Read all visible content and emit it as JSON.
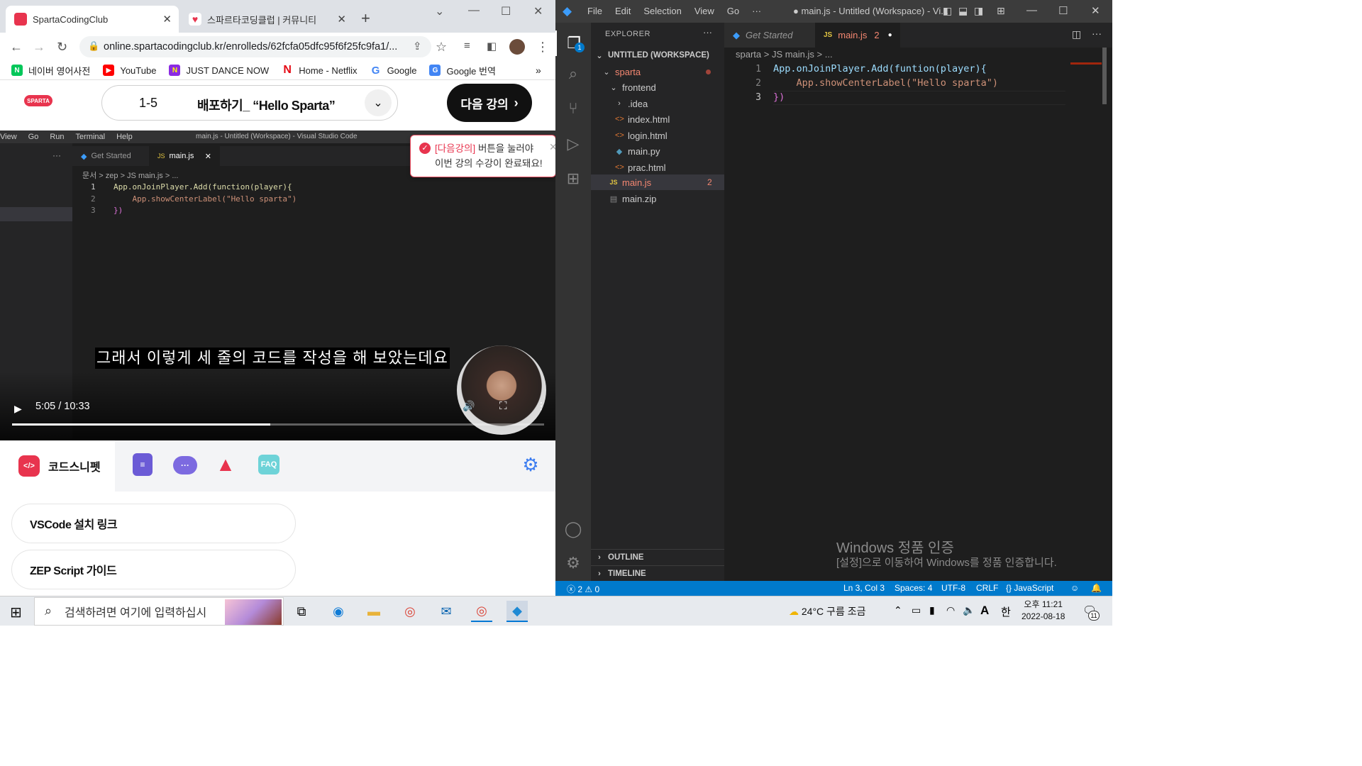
{
  "chrome": {
    "tabs": [
      {
        "title": "SpartaCodingClub",
        "active": true
      },
      {
        "title": "스파르타코딩클럽 | 커뮤니티",
        "active": false
      }
    ],
    "url": "online.spartacodingclub.kr/enrolleds/62fcfa05dfc95f6f25fc9fa1/...",
    "bookmarks": [
      {
        "label": "네이버 영어사전",
        "icon": "naver-icon",
        "color": "#03c75a"
      },
      {
        "label": "YouTube",
        "icon": "youtube-icon",
        "color": "#ff0000"
      },
      {
        "label": "JUST DANCE NOW",
        "icon": "just-dance-icon",
        "color": "#8b2be2"
      },
      {
        "label": "Home - Netflix",
        "icon": "netflix-icon",
        "color": "#e50914"
      },
      {
        "label": "Google",
        "icon": "google-icon",
        "color": "#4285f4"
      },
      {
        "label": "Google 번역",
        "icon": "google-translate-icon",
        "color": "#4285f4"
      }
    ],
    "bookmarks_more": "»"
  },
  "page": {
    "logo": "SPARTA",
    "lesson_number": "1-5",
    "lesson_title": "배포하기_ “Hello Sparta”",
    "next_button": "다음 강의",
    "tooltip_line1_bold": "[다음강의]",
    "tooltip_line1_rest": " 버튼을 눌러야",
    "tooltip_line2": "이번 강의 수강이 완료돼요!",
    "video": {
      "menu": [
        "View",
        "Go",
        "Run",
        "Terminal",
        "Help"
      ],
      "window_title": "main.js - Untitled (Workspace) - Visual Studio Code",
      "tabs": [
        "Get Started",
        "main.js"
      ],
      "breadcrumb": "문서 > zep > JS main.js > ...",
      "code_lines": [
        "App.onJoinPlayer.Add(function(player){",
        "    App.showCenterLabel(\"Hello sparta\")",
        "})"
      ],
      "subtitle": "그래서 이렇게 세 줄의 코드를 작성을 해 보았는데요",
      "time": "5:05 / 10:33",
      "progress": 0.485
    },
    "snippet_tab": "코드스니펫",
    "snippet_icon_text": "</>",
    "faq": "FAQ",
    "links": [
      "VSCode 설치 링크",
      "ZEP Script 가이드"
    ]
  },
  "vscode": {
    "menu": [
      "File",
      "Edit",
      "Selection",
      "View",
      "Go",
      "···"
    ],
    "title": "● main.js - Untitled (Workspace) - Vi...",
    "explorer_title": "EXPLORER",
    "workspace": "UNTITLED (WORKSPACE)",
    "tree": [
      {
        "label": "sparta",
        "depth": 0,
        "type": "folder-open",
        "color": "#f48771"
      },
      {
        "label": "frontend",
        "depth": 1,
        "type": "folder-open",
        "color": "#cccccc"
      },
      {
        "label": ".idea",
        "depth": 2,
        "type": "folder",
        "color": "#cccccc"
      },
      {
        "label": "index.html",
        "depth": 2,
        "type": "html",
        "color": "#cccccc"
      },
      {
        "label": "login.html",
        "depth": 2,
        "type": "html",
        "color": "#cccccc"
      },
      {
        "label": "main.py",
        "depth": 2,
        "type": "py",
        "color": "#cccccc"
      },
      {
        "label": "prac.html",
        "depth": 2,
        "type": "html",
        "color": "#cccccc"
      },
      {
        "label": "main.js",
        "depth": 1,
        "type": "js",
        "color": "#f48771",
        "badge": "2",
        "selected": true
      },
      {
        "label": "main.zip",
        "depth": 1,
        "type": "zip",
        "color": "#cccccc"
      }
    ],
    "outline": "OUTLINE",
    "timeline": "TIMELINE",
    "editor_tabs": [
      {
        "label": "Get Started",
        "active": false
      },
      {
        "label": "main.js",
        "active": true,
        "badge": "2"
      }
    ],
    "breadcrumb": "sparta > JS main.js > ...",
    "code": [
      {
        "num": "1",
        "text": "App.onJoinPlayer.Add(funtion(player){"
      },
      {
        "num": "2",
        "text": "    App.showCenterLabel(\"Hello sparta\")"
      },
      {
        "num": "3",
        "text": "})"
      }
    ],
    "watermark_title": "Windows 정품 인증",
    "watermark_sub": "[설정]으로 이동하여 Windows를 정품 인증합니다.",
    "status": {
      "errors": "2",
      "warnings": "0",
      "position": "Ln 3, Col 3",
      "spaces": "Spaces: 4",
      "encoding": "UTF-8",
      "eol": "CRLF",
      "language": "JavaScript",
      "language_braces": "{}"
    },
    "accounts_badge": "1"
  },
  "taskbar": {
    "search_placeholder": "검색하려면 여기에 입력하십시",
    "weather": "24°C 구름 조금",
    "ime_a": "A",
    "ime_han": "한",
    "time": "오후 11:21",
    "date": "2022-08-18",
    "notification_count": "11"
  }
}
